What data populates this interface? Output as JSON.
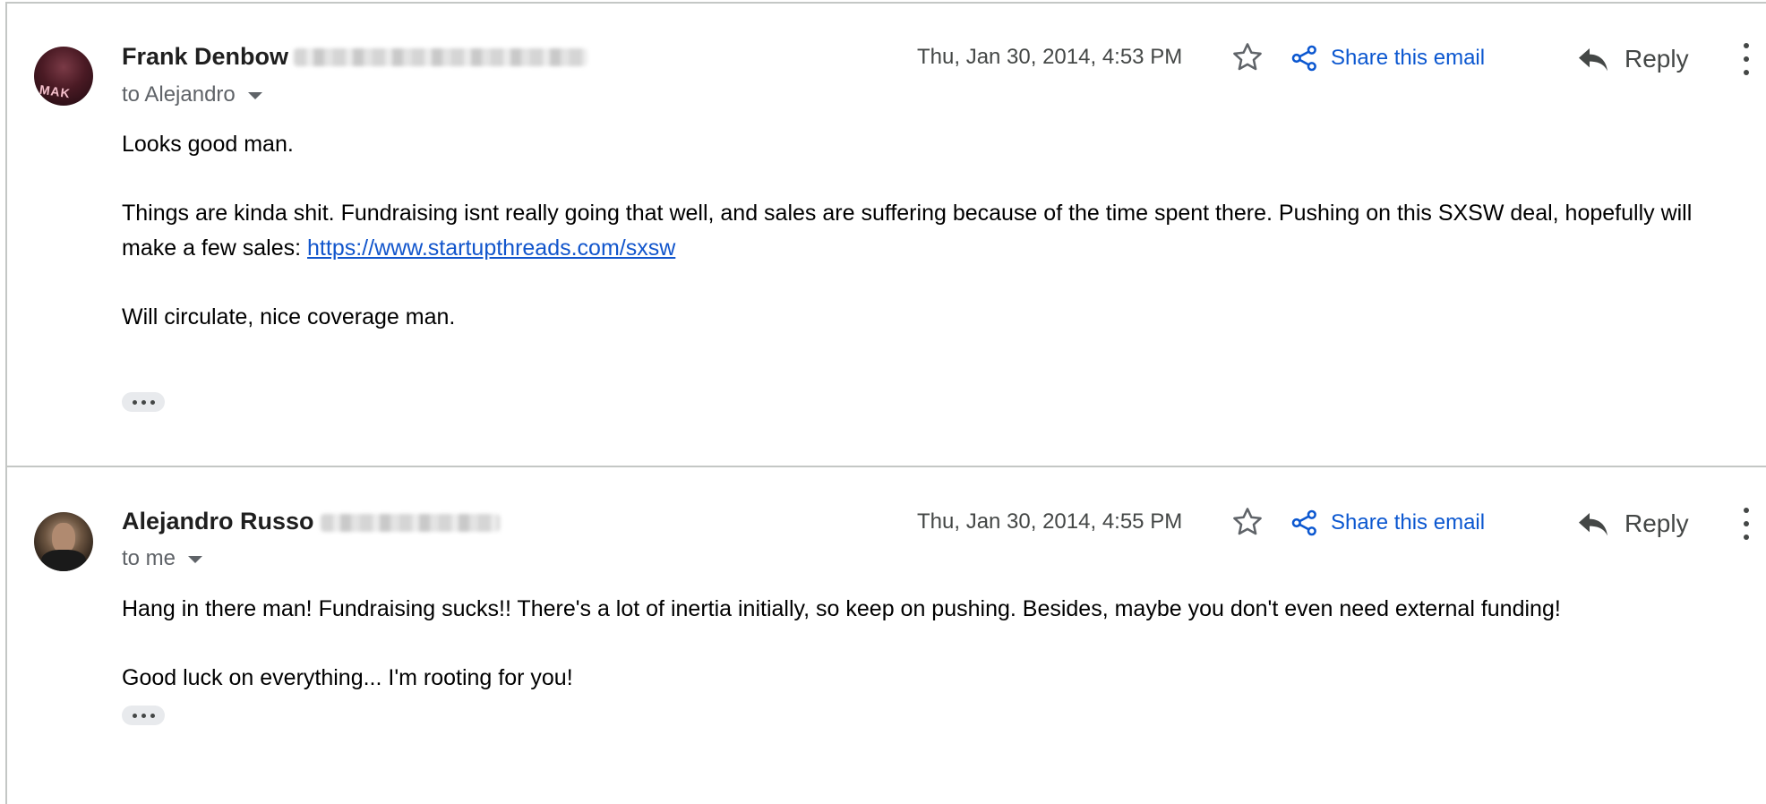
{
  "messages": [
    {
      "sender": "Frank Denbow",
      "sender_email": "",
      "recipient": "to Alejandro",
      "date": "Thu, Jan 30, 2014, 4:53 PM",
      "share_label": "Share this email",
      "reply_label": "Reply",
      "avatar_text": "MAK",
      "body": {
        "p1": "Looks good man.",
        "p2": "Things are kinda shit. Fundraising isnt really going that well, and sales are suffering because of the time spent there. Pushing on this SXSW deal, hopefully will make a few sales: ",
        "link": "https://www.startupthreads.com/sxsw",
        "p3": "Will circulate, nice coverage man."
      }
    },
    {
      "sender": "Alejandro Russo",
      "sender_email": "",
      "recipient": "to me",
      "date": "Thu, Jan 30, 2014, 4:55 PM",
      "share_label": "Share this email",
      "reply_label": "Reply",
      "body": {
        "p1": "Hang in there man! Fundraising sucks!! There's a lot of inertia initially, so keep on pushing. Besides, maybe you don't even need external funding!",
        "p2": "Good luck on everything... I'm rooting for you!"
      }
    }
  ],
  "icons": {
    "star": "star-outline-icon",
    "share": "share-icon",
    "reply": "reply-arrow-icon",
    "more": "more-vert-icon",
    "caret": "caret-down-icon",
    "ellipsis": "show-trimmed-content-icon"
  },
  "colors": {
    "link": "#1155cc",
    "share_accent": "#0b57d0",
    "divider": "#c4c7c5",
    "secondary_text": "#5f6368"
  }
}
